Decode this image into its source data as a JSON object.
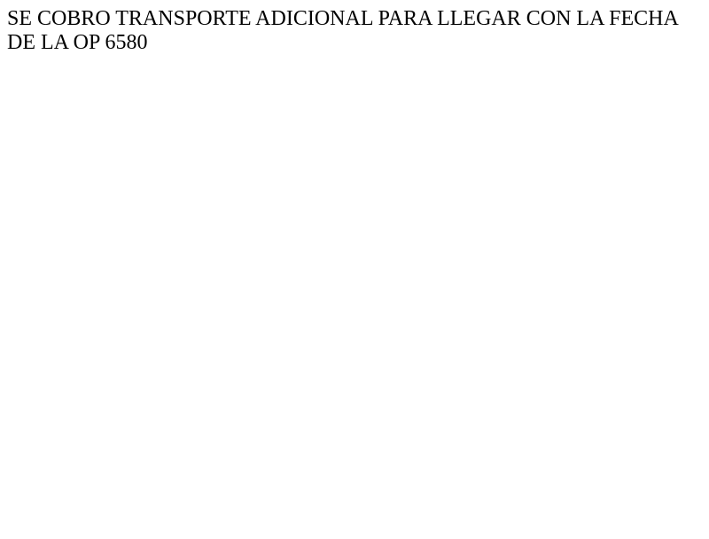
{
  "document": {
    "text": "SE COBRO TRANSPORTE ADICIONAL PARA LLEGAR CON LA FECHA DE LA OP 6580"
  }
}
